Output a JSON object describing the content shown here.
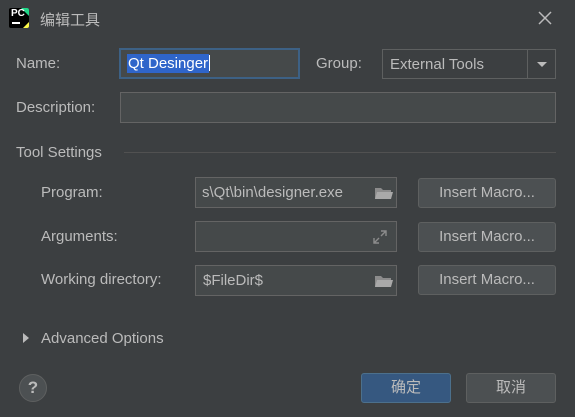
{
  "window": {
    "title": "编辑工具",
    "app_icon_text": "PC"
  },
  "form": {
    "name_label": "Name:",
    "name_value": "Qt Desinger",
    "group_label": "Group:",
    "group_value": "External Tools",
    "description_label": "Description:",
    "description_value": ""
  },
  "tool_settings": {
    "section_title": "Tool Settings",
    "program_label": "Program:",
    "program_value": "s\\Qt\\bin\\designer.exe",
    "arguments_label": "Arguments:",
    "arguments_value": "",
    "working_dir_label": "Working directory:",
    "working_dir_value": "$FileDir$",
    "insert_macro_label": "Insert Macro..."
  },
  "advanced": {
    "label": "Advanced Options"
  },
  "footer": {
    "help_label": "?",
    "ok_label": "确定",
    "cancel_label": "取消"
  },
  "colors": {
    "background": "#3c3f41",
    "field_bg": "#45494a",
    "selection": "#2f65ca",
    "focus_border": "#3d6185",
    "primary_button": "#365880",
    "text": "#bbbbbb"
  }
}
